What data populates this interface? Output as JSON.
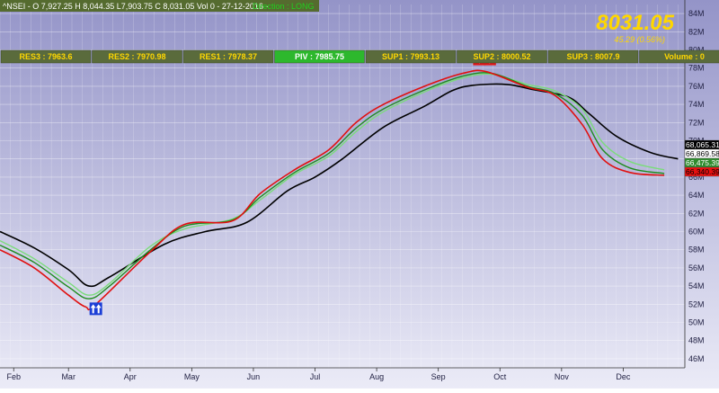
{
  "header": {
    "text": "^NSEI - O 7,927.25 H 8,044.35  L7,903.75    C 8,031.05 Vol 0  - 27-12-2016 -",
    "direction": "Direction : LONG",
    "price": "8031.05",
    "change": "45.29  (0.56%)"
  },
  "pivot_bar": [
    {
      "label": "RES3 : 7963.6"
    },
    {
      "label": "RES2 : 7970.98"
    },
    {
      "label": "RES1 : 7978.37"
    },
    {
      "label": "PIV : 7985.75",
      "highlight": true
    },
    {
      "label": "SUP1 : 7993.13"
    },
    {
      "label": "SUP2 : 8000.52"
    },
    {
      "label": "SUP3 : 8007.9"
    },
    {
      "label": "Volume : 0"
    }
  ],
  "value_tags": [
    {
      "text": "68,065.31",
      "bg": "#000000",
      "fg": "#ffffff"
    },
    {
      "text": "66,869.58",
      "bg": "#ffffff",
      "fg": "#000000"
    },
    {
      "text": "66,475.39",
      "bg": "#2e8b2e",
      "fg": "#ffffff"
    },
    {
      "text": "66,340.39",
      "bg": "#e81010",
      "fg": "#000000"
    }
  ],
  "colors": {
    "background_top": "#9494c8",
    "background_bottom": "#ebebf7",
    "header_bar": "#556b2f",
    "pivot_cell": "#5a6b3c",
    "pivot_text": "#ffd700",
    "pivot_highlight": "#2db82d",
    "direction_text": "#1fd11f",
    "price_text": "#ffd700",
    "buy_arrow_box": "#1c3fd6",
    "sell_arrow_box": "#e01818"
  },
  "chart_data": {
    "type": "line",
    "x_unit": "weeks",
    "x_tick_labels": [
      "Feb",
      "Mar",
      "Apr",
      "May",
      "Jun",
      "Jul",
      "Aug",
      "Sep",
      "Oct",
      "Nov",
      "Dec"
    ],
    "x_tick_weeks": [
      2,
      10,
      19,
      28,
      37,
      46,
      55,
      64,
      73,
      82,
      91
    ],
    "yticks": [
      "46M",
      "48M",
      "50M",
      "52M",
      "54M",
      "56M",
      "58M",
      "60M",
      "62M",
      "64M",
      "66M",
      "68M",
      "70M",
      "72M",
      "74M",
      "76M",
      "78M",
      "80M",
      "82M",
      "84M"
    ],
    "ylim": [
      45,
      85
    ],
    "grid": true,
    "series": [
      {
        "color": "#000000",
        "width": 1.6,
        "points": [
          [
            0,
            60
          ],
          [
            5,
            58.2
          ],
          [
            10,
            55.8
          ],
          [
            13,
            54
          ],
          [
            16,
            55
          ],
          [
            24,
            58.6
          ],
          [
            30,
            60
          ],
          [
            36,
            61
          ],
          [
            42,
            64.5
          ],
          [
            46,
            66
          ],
          [
            50,
            68
          ],
          [
            56,
            71.5
          ],
          [
            62,
            73.8
          ],
          [
            66,
            75.5
          ],
          [
            69,
            76.1
          ],
          [
            74,
            76.2
          ],
          [
            78,
            75.6
          ],
          [
            83,
            74.8
          ],
          [
            86,
            73
          ],
          [
            90,
            70.5
          ],
          [
            95,
            68.7
          ],
          [
            99,
            68
          ]
        ]
      },
      {
        "color": "#7bdc7b",
        "width": 1.4,
        "points": [
          [
            0,
            59
          ],
          [
            5,
            57
          ],
          [
            10,
            54.4
          ],
          [
            13,
            53
          ],
          [
            16,
            54.3
          ],
          [
            22,
            58.4
          ],
          [
            27,
            60.3
          ],
          [
            34,
            61.4
          ],
          [
            38,
            63.5
          ],
          [
            43,
            66.3
          ],
          [
            48,
            68.3
          ],
          [
            52,
            71
          ],
          [
            56,
            73.2
          ],
          [
            63,
            75.7
          ],
          [
            68,
            77
          ],
          [
            72,
            77.3
          ],
          [
            77,
            76.2
          ],
          [
            81,
            75.5
          ],
          [
            85,
            73.5
          ],
          [
            88,
            69.8
          ],
          [
            92,
            67.7
          ],
          [
            97,
            66.8
          ]
        ]
      },
      {
        "color": "#1e8c1e",
        "width": 1.4,
        "points": [
          [
            0,
            58.5
          ],
          [
            5,
            56.6
          ],
          [
            10,
            53.9
          ],
          [
            13,
            52.6
          ],
          [
            16,
            54
          ],
          [
            22,
            58
          ],
          [
            27,
            60.6
          ],
          [
            34,
            61.3
          ],
          [
            38,
            63.8
          ],
          [
            43,
            66.5
          ],
          [
            48,
            68.6
          ],
          [
            52,
            71.4
          ],
          [
            56,
            73.5
          ],
          [
            63,
            75.9
          ],
          [
            68,
            77.2
          ],
          [
            72,
            77.4
          ],
          [
            77,
            76
          ],
          [
            81,
            75.2
          ],
          [
            85,
            72.8
          ],
          [
            88,
            69
          ],
          [
            92,
            67
          ],
          [
            97,
            66.4
          ]
        ]
      },
      {
        "color": "#e01010",
        "width": 1.6,
        "points": [
          [
            0,
            58
          ],
          [
            5,
            56
          ],
          [
            10,
            53
          ],
          [
            12.5,
            51.7
          ],
          [
            14,
            52
          ],
          [
            22,
            57.8
          ],
          [
            27,
            60.8
          ],
          [
            34,
            61.2
          ],
          [
            38,
            64.2
          ],
          [
            43,
            66.8
          ],
          [
            48,
            69
          ],
          [
            52,
            72
          ],
          [
            56,
            74
          ],
          [
            63,
            76.3
          ],
          [
            68,
            77.5
          ],
          [
            71,
            77.6
          ],
          [
            77,
            75.9
          ],
          [
            81,
            75
          ],
          [
            85,
            71.8
          ],
          [
            88,
            68
          ],
          [
            92,
            66.5
          ],
          [
            97,
            66.2
          ]
        ]
      }
    ],
    "signals": [
      {
        "type": "buy",
        "x": 14,
        "y": 51.5
      },
      {
        "type": "sell",
        "x": 70,
        "y": 79
      },
      {
        "type": "sell",
        "x": 71.5,
        "y": 79
      }
    ]
  }
}
